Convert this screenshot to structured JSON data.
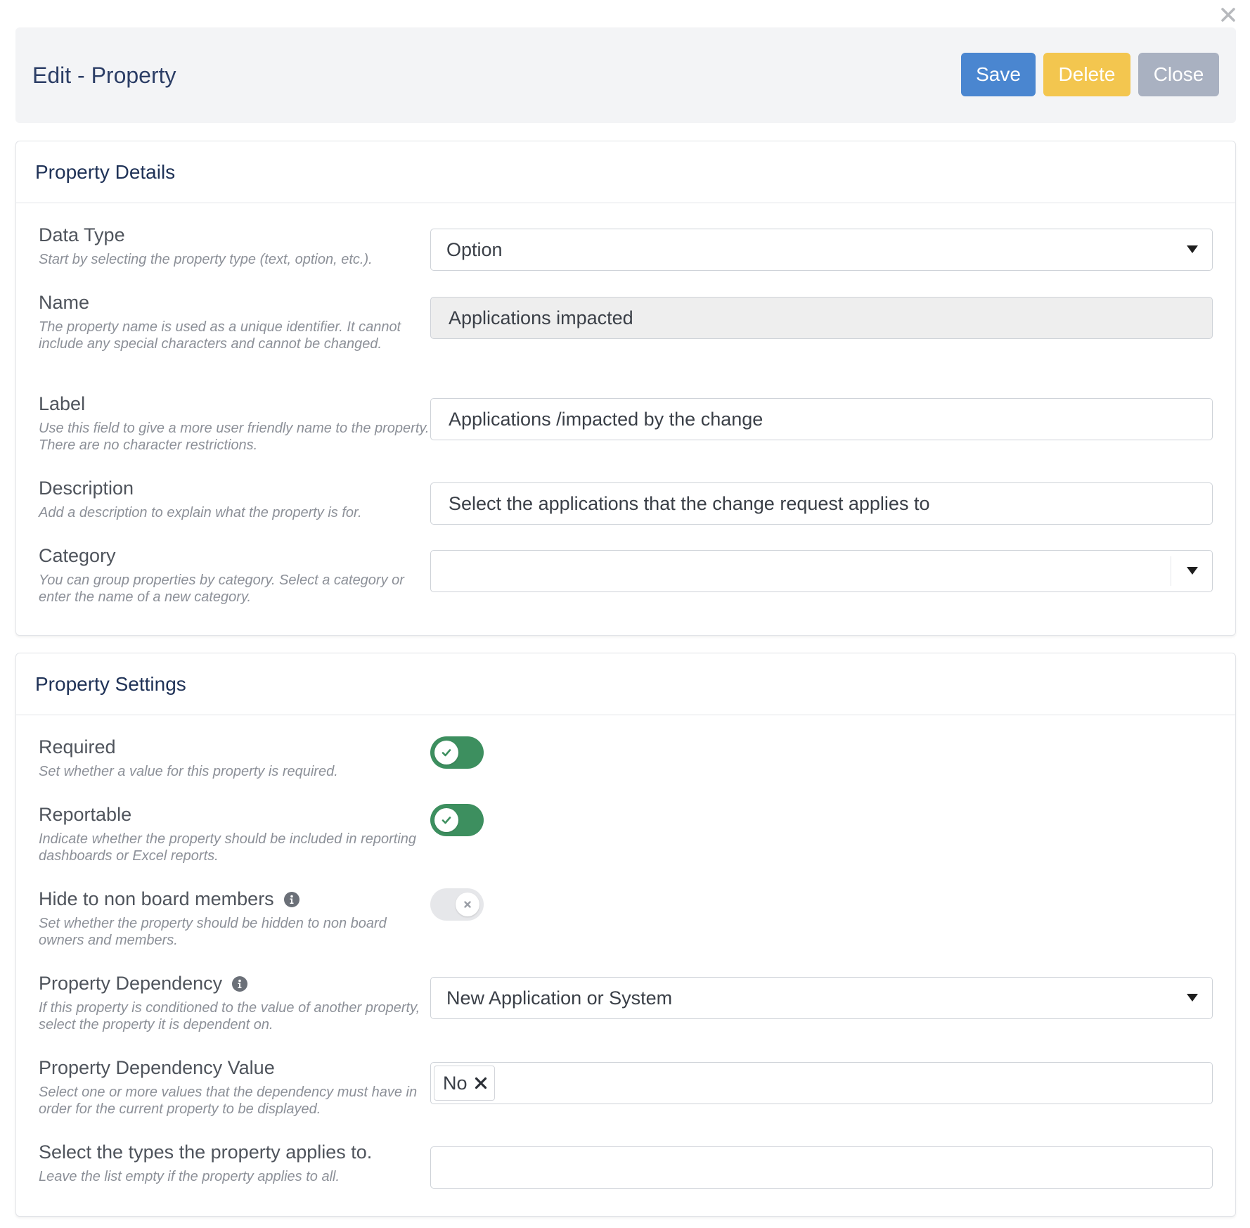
{
  "header": {
    "title": "Edit - Property",
    "save_label": "Save",
    "delete_label": "Delete",
    "close_label": "Close"
  },
  "details": {
    "title": "Property Details",
    "data_type": {
      "label": "Data Type",
      "hint": "Start by selecting the property type (text, option, etc.).",
      "value": "Option"
    },
    "name": {
      "label": "Name",
      "hint": "The property name is used as a unique identifier. It cannot include any special characters and cannot be changed.",
      "value": "Applications impacted"
    },
    "label": {
      "label": "Label",
      "hint": "Use this field to give a more user friendly name to the property. There are no character restrictions.",
      "value": "Applications /impacted by the change"
    },
    "description": {
      "label": "Description",
      "hint": "Add a description to explain what the property is for.",
      "value": "Select the applications that the change request applies to"
    },
    "category": {
      "label": "Category",
      "hint": "You can group properties by category. Select a category or enter the name of a new category.",
      "value": ""
    }
  },
  "settings": {
    "title": "Property Settings",
    "required": {
      "label": "Required",
      "hint": "Set whether a value for this property is required.",
      "enabled": true
    },
    "reportable": {
      "label": "Reportable",
      "hint": "Indicate whether the property should be included in reporting dashboards or Excel reports.",
      "enabled": true
    },
    "hide_non_board": {
      "label": "Hide to non board members",
      "hint": "Set whether the property should be hidden to non board owners and members.",
      "enabled": false
    },
    "dependency": {
      "label": "Property Dependency",
      "hint": "If this property is conditioned to the value of another property, select the property it is dependent on.",
      "value": "New Application or System"
    },
    "dependency_value": {
      "label": "Property Dependency Value",
      "hint": "Select one or more values that the dependency must have in order for the current property to be displayed.",
      "tags": [
        "No"
      ]
    },
    "applies_to": {
      "label": "Select the types the property applies to.",
      "hint": "Leave the list empty if the property applies to all.",
      "value": ""
    }
  },
  "colors": {
    "primary": "#4a86d0",
    "warning": "#f3c64f",
    "muted": "#a9b1c1",
    "toggle_on": "#3d8f5f",
    "toggle_off": "#e6e7ea"
  },
  "icons": {
    "dialog_close": "close-icon",
    "toggle_on": "check-icon",
    "toggle_off": "x-icon",
    "info": "info-icon",
    "tag_remove": "remove-icon"
  }
}
